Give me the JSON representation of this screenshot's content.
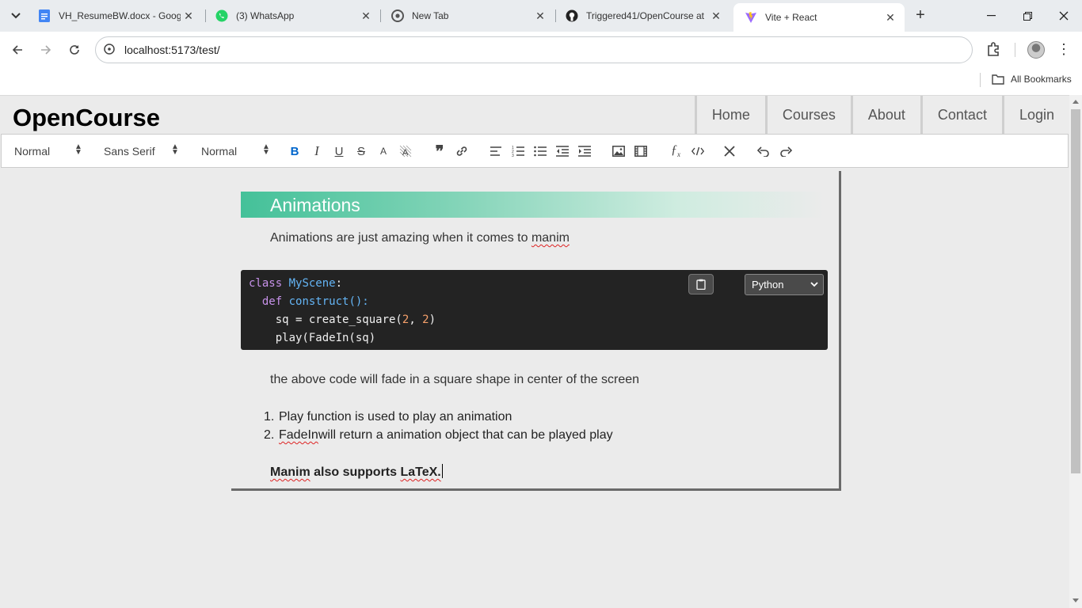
{
  "browser": {
    "tabs": [
      {
        "title": "VH_ResumeBW.docx - Google Docs",
        "icon": "google-docs-icon",
        "active": false
      },
      {
        "title": "(3) WhatsApp",
        "icon": "whatsapp-icon",
        "active": false
      },
      {
        "title": "New Tab",
        "icon": "chrome-icon",
        "active": false
      },
      {
        "title": "Triggered41/OpenCourse at",
        "icon": "github-icon",
        "active": false
      },
      {
        "title": "Vite + React",
        "icon": "vite-icon",
        "active": true
      }
    ],
    "url": "localhost:5173/test/",
    "bookmarks_label": "All Bookmarks"
  },
  "site": {
    "logo": "OpenCourse",
    "nav": [
      "Home",
      "Courses",
      "About",
      "Contact",
      "Login"
    ]
  },
  "editor_toolbar": {
    "header_picker": "Normal",
    "font_picker": "Sans Serif",
    "size_picker": "Normal",
    "buttons": [
      "bold",
      "italic",
      "underline",
      "strike",
      "color",
      "background",
      "blockquote",
      "link",
      "align",
      "ordered-list",
      "bullet-list",
      "outdent",
      "indent",
      "image",
      "video",
      "formula",
      "code-block",
      "clean",
      "undo",
      "redo"
    ]
  },
  "content": {
    "heading": "Animations",
    "intro_prefix": "Animations are just amazing when it comes to ",
    "intro_word": "manim",
    "code": {
      "language": "Python",
      "line1_kw": "class",
      "line1_name": "MyScene",
      "line1_end": ":",
      "line2_kw": "def",
      "line2_fn": "construct():",
      "line3_a": "sq = create_square(",
      "line3_n1": "2",
      "line3_b": ", ",
      "line3_n2": "2",
      "line3_c": ")",
      "line4": "play(FadeIn(sq)"
    },
    "after_code": "the above code will fade in a square shape in center of the screen",
    "list": [
      {
        "marker": "1.",
        "pre": "",
        "squiggle": "",
        "text": "Play function is used to play an animation"
      },
      {
        "marker": "2.",
        "pre": "",
        "squiggle": "FadeIn",
        "text": " will return a animation object that can be played play"
      }
    ],
    "bold_word1": "Manim",
    "bold_mid": " also supports ",
    "bold_word2": "LaTeX."
  },
  "colors": {
    "heading_gradient_start": "#44c199",
    "code_bg": "#232323",
    "keyword": "#c792ea",
    "name": "#64b5f6",
    "number": "#f5a06b"
  }
}
